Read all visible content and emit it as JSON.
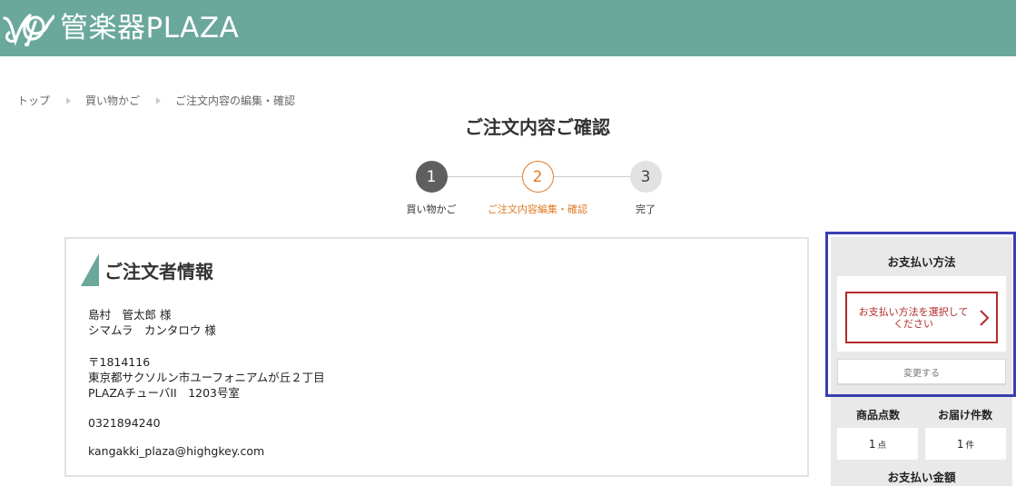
{
  "header": {
    "brand": "管楽器PLAZA",
    "logo_icon": "clef-music-icon",
    "brand_color": "#6aa89c"
  },
  "breadcrumb": {
    "items": [
      "トップ",
      "買い物かご",
      "ご注文内容の編集・確認"
    ]
  },
  "page_title": "ご注文内容ご確認",
  "steps": [
    {
      "number": "1",
      "label": "買い物かご",
      "state": "done"
    },
    {
      "number": "2",
      "label": "ご注文内容編集・確認",
      "state": "current"
    },
    {
      "number": "3",
      "label": "完了",
      "state": "upcoming"
    }
  ],
  "colors": {
    "accent_orange": "#e07b25",
    "error_red": "#b32a2a",
    "highlight_blue": "#3b3fb1"
  },
  "orderer": {
    "section_title": "ご注文者情報",
    "name": "島村　管太郎 様",
    "name_kana": "シマムラ　カンタロウ 様",
    "postal": "〒1814116",
    "address1": "東京都サクソルン市ユーフォニアムが丘２丁目",
    "address2": "PLAZAチューバII　1203号室",
    "phone": "0321894240",
    "email": "kangakki_plaza@highgkey.com"
  },
  "payment": {
    "title": "お支払い方法",
    "select_prompt": "お支払い方法を選択してください",
    "change_label": "変更する"
  },
  "summary": {
    "item_count_label": "商品点数",
    "item_count": "1",
    "item_unit": "点",
    "delivery_count_label": "お届け件数",
    "delivery_count": "1",
    "delivery_unit": "件",
    "total_label": "お支払い金額"
  }
}
